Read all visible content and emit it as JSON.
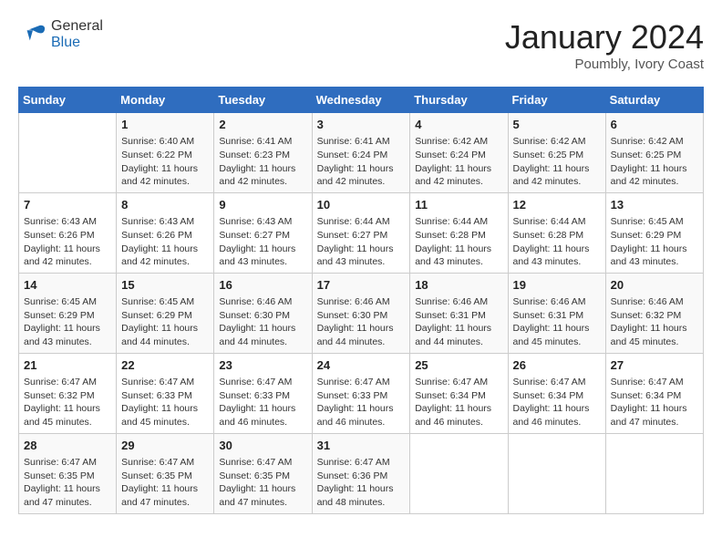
{
  "header": {
    "logo_general": "General",
    "logo_blue": "Blue",
    "month_title": "January 2024",
    "location": "Poumbly, Ivory Coast"
  },
  "days_of_week": [
    "Sunday",
    "Monday",
    "Tuesday",
    "Wednesday",
    "Thursday",
    "Friday",
    "Saturday"
  ],
  "weeks": [
    [
      {
        "day": null
      },
      {
        "day": 1,
        "sunrise": "6:40 AM",
        "sunset": "6:22 PM",
        "daylight": "11 hours and 42 minutes."
      },
      {
        "day": 2,
        "sunrise": "6:41 AM",
        "sunset": "6:23 PM",
        "daylight": "11 hours and 42 minutes."
      },
      {
        "day": 3,
        "sunrise": "6:41 AM",
        "sunset": "6:24 PM",
        "daylight": "11 hours and 42 minutes."
      },
      {
        "day": 4,
        "sunrise": "6:42 AM",
        "sunset": "6:24 PM",
        "daylight": "11 hours and 42 minutes."
      },
      {
        "day": 5,
        "sunrise": "6:42 AM",
        "sunset": "6:25 PM",
        "daylight": "11 hours and 42 minutes."
      },
      {
        "day": 6,
        "sunrise": "6:42 AM",
        "sunset": "6:25 PM",
        "daylight": "11 hours and 42 minutes."
      }
    ],
    [
      {
        "day": 7,
        "sunrise": "6:43 AM",
        "sunset": "6:26 PM",
        "daylight": "11 hours and 42 minutes."
      },
      {
        "day": 8,
        "sunrise": "6:43 AM",
        "sunset": "6:26 PM",
        "daylight": "11 hours and 42 minutes."
      },
      {
        "day": 9,
        "sunrise": "6:43 AM",
        "sunset": "6:27 PM",
        "daylight": "11 hours and 43 minutes."
      },
      {
        "day": 10,
        "sunrise": "6:44 AM",
        "sunset": "6:27 PM",
        "daylight": "11 hours and 43 minutes."
      },
      {
        "day": 11,
        "sunrise": "6:44 AM",
        "sunset": "6:28 PM",
        "daylight": "11 hours and 43 minutes."
      },
      {
        "day": 12,
        "sunrise": "6:44 AM",
        "sunset": "6:28 PM",
        "daylight": "11 hours and 43 minutes."
      },
      {
        "day": 13,
        "sunrise": "6:45 AM",
        "sunset": "6:29 PM",
        "daylight": "11 hours and 43 minutes."
      }
    ],
    [
      {
        "day": 14,
        "sunrise": "6:45 AM",
        "sunset": "6:29 PM",
        "daylight": "11 hours and 43 minutes."
      },
      {
        "day": 15,
        "sunrise": "6:45 AM",
        "sunset": "6:29 PM",
        "daylight": "11 hours and 44 minutes."
      },
      {
        "day": 16,
        "sunrise": "6:46 AM",
        "sunset": "6:30 PM",
        "daylight": "11 hours and 44 minutes."
      },
      {
        "day": 17,
        "sunrise": "6:46 AM",
        "sunset": "6:30 PM",
        "daylight": "11 hours and 44 minutes."
      },
      {
        "day": 18,
        "sunrise": "6:46 AM",
        "sunset": "6:31 PM",
        "daylight": "11 hours and 44 minutes."
      },
      {
        "day": 19,
        "sunrise": "6:46 AM",
        "sunset": "6:31 PM",
        "daylight": "11 hours and 45 minutes."
      },
      {
        "day": 20,
        "sunrise": "6:46 AM",
        "sunset": "6:32 PM",
        "daylight": "11 hours and 45 minutes."
      }
    ],
    [
      {
        "day": 21,
        "sunrise": "6:47 AM",
        "sunset": "6:32 PM",
        "daylight": "11 hours and 45 minutes."
      },
      {
        "day": 22,
        "sunrise": "6:47 AM",
        "sunset": "6:33 PM",
        "daylight": "11 hours and 45 minutes."
      },
      {
        "day": 23,
        "sunrise": "6:47 AM",
        "sunset": "6:33 PM",
        "daylight": "11 hours and 46 minutes."
      },
      {
        "day": 24,
        "sunrise": "6:47 AM",
        "sunset": "6:33 PM",
        "daylight": "11 hours and 46 minutes."
      },
      {
        "day": 25,
        "sunrise": "6:47 AM",
        "sunset": "6:34 PM",
        "daylight": "11 hours and 46 minutes."
      },
      {
        "day": 26,
        "sunrise": "6:47 AM",
        "sunset": "6:34 PM",
        "daylight": "11 hours and 46 minutes."
      },
      {
        "day": 27,
        "sunrise": "6:47 AM",
        "sunset": "6:34 PM",
        "daylight": "11 hours and 47 minutes."
      }
    ],
    [
      {
        "day": 28,
        "sunrise": "6:47 AM",
        "sunset": "6:35 PM",
        "daylight": "11 hours and 47 minutes."
      },
      {
        "day": 29,
        "sunrise": "6:47 AM",
        "sunset": "6:35 PM",
        "daylight": "11 hours and 47 minutes."
      },
      {
        "day": 30,
        "sunrise": "6:47 AM",
        "sunset": "6:35 PM",
        "daylight": "11 hours and 47 minutes."
      },
      {
        "day": 31,
        "sunrise": "6:47 AM",
        "sunset": "6:36 PM",
        "daylight": "11 hours and 48 minutes."
      },
      {
        "day": null
      },
      {
        "day": null
      },
      {
        "day": null
      }
    ]
  ],
  "labels": {
    "sunrise": "Sunrise:",
    "sunset": "Sunset:",
    "daylight": "Daylight:"
  }
}
